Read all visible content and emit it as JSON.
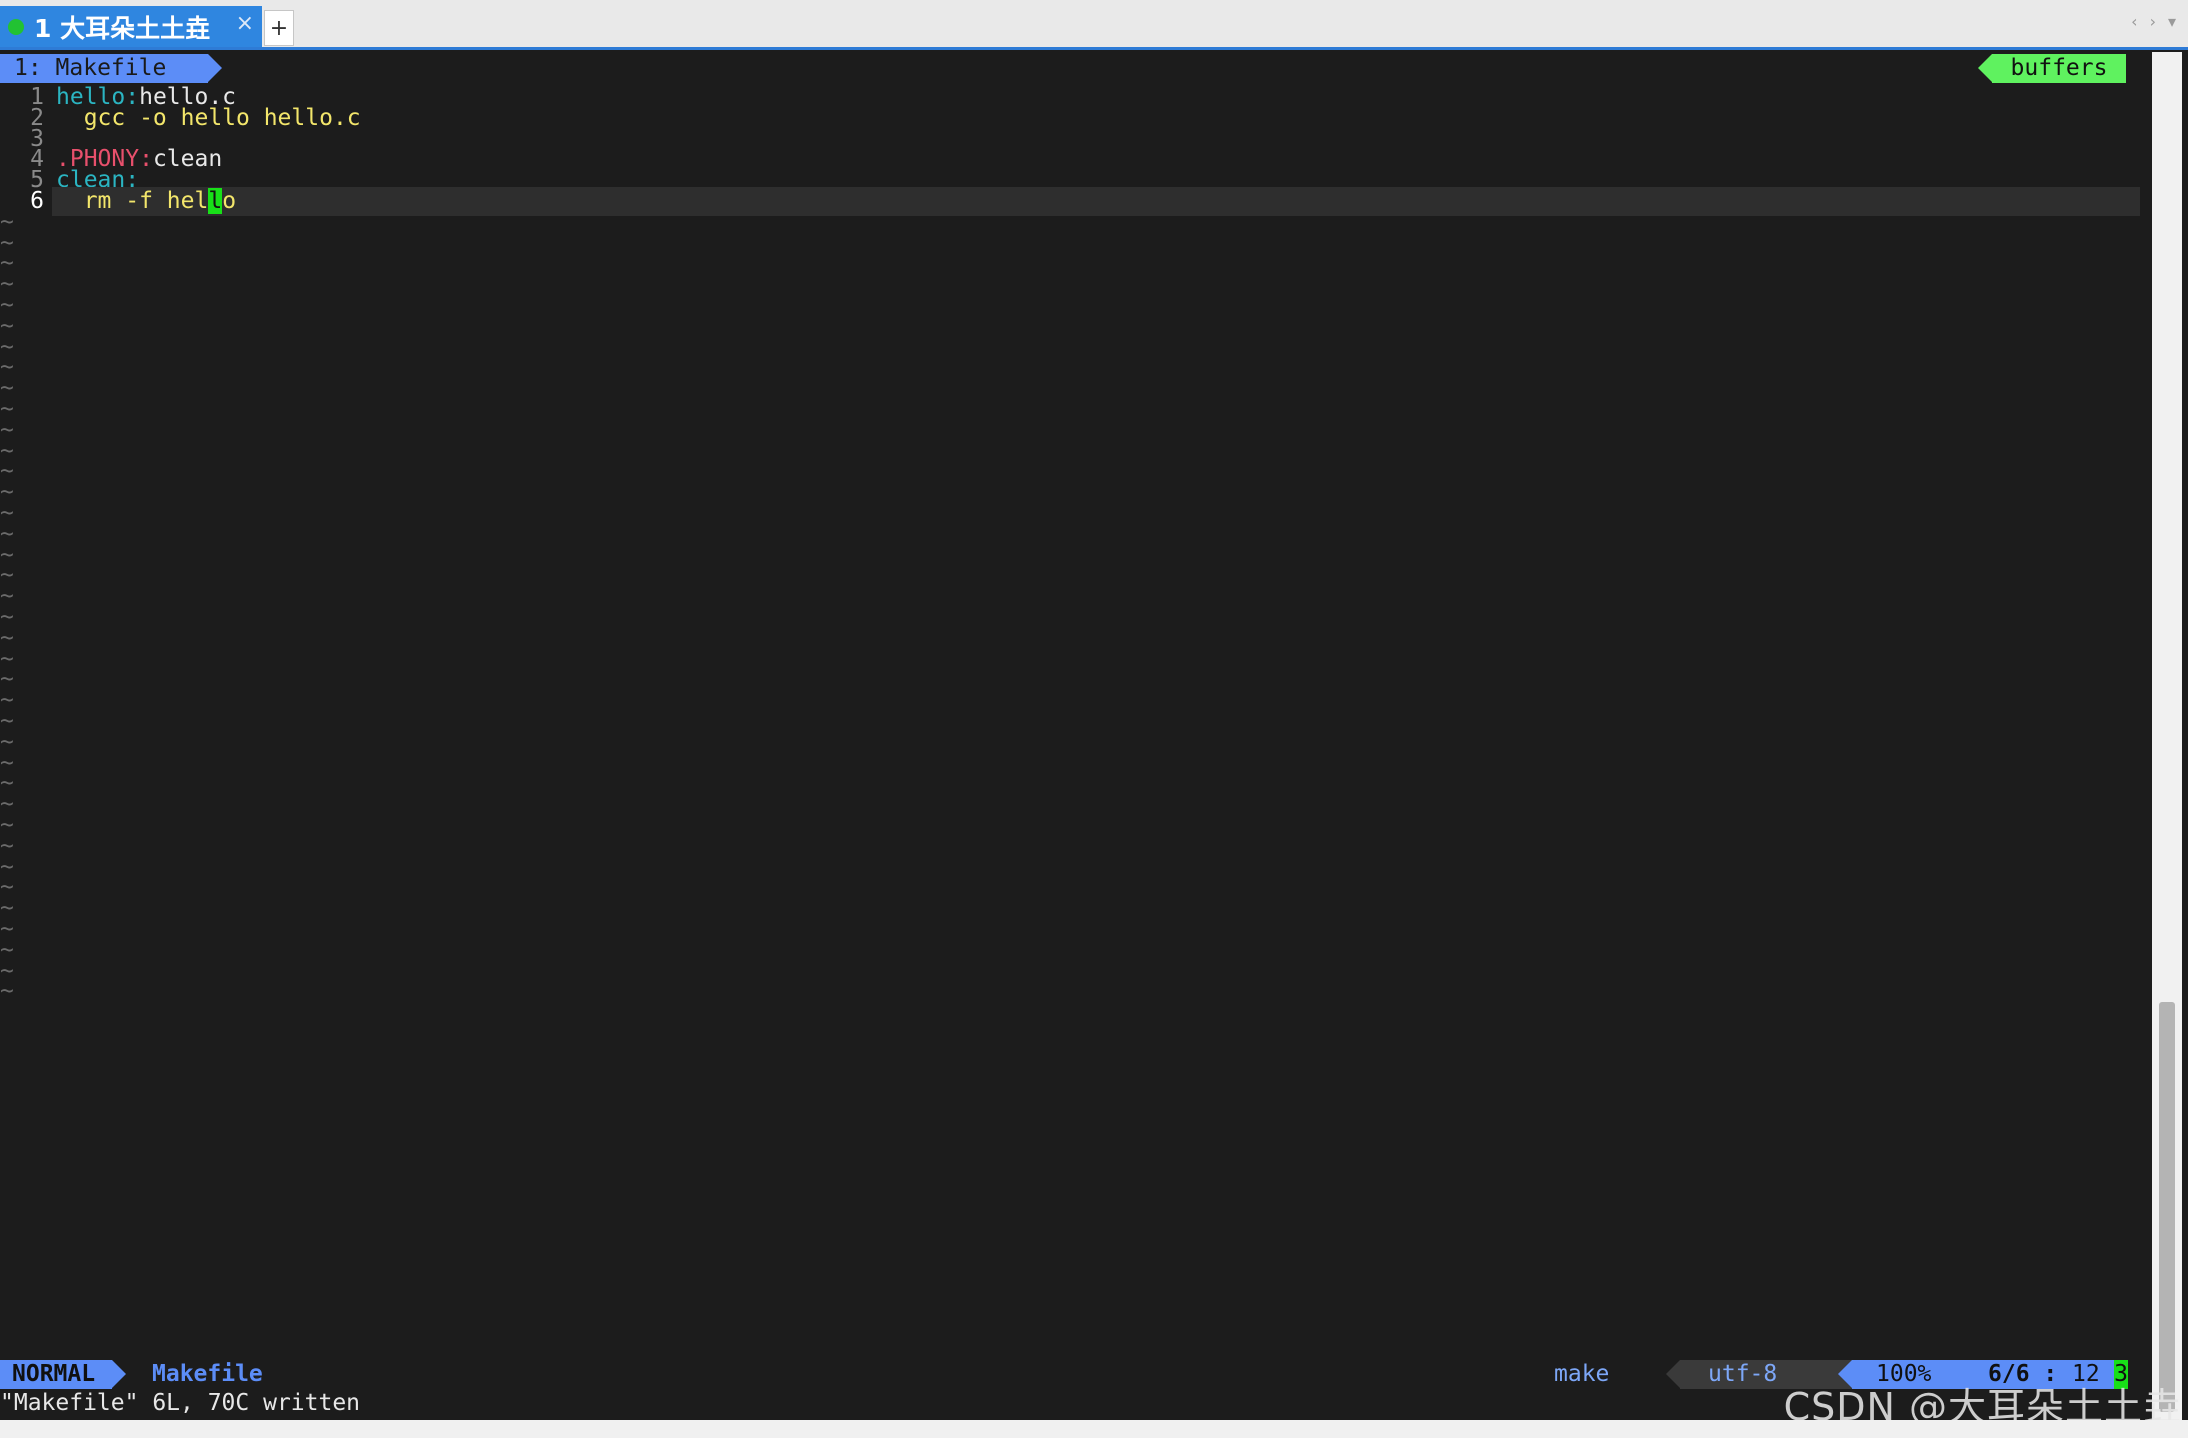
{
  "tabbar": {
    "active_tab_title": "1 大耳朵土土垚",
    "close_glyph": "×",
    "add_glyph": "+",
    "nav_left_glyph": "‹",
    "nav_right_glyph": "›",
    "menu_glyph": "▾",
    "status_dot_color": "#22c232"
  },
  "bufferline": {
    "current_buffer": "1: Makefile",
    "right_label": "buffers"
  },
  "editor": {
    "lines": [
      {
        "number": "1",
        "parts": [
          {
            "text": "hello:",
            "style": "target"
          },
          {
            "text": "hello.c",
            "style": "plain"
          }
        ]
      },
      {
        "number": "2",
        "parts": [
          {
            "text": "  gcc -o hello hello.c",
            "style": "yellow"
          }
        ]
      },
      {
        "number": "3",
        "parts": []
      },
      {
        "number": "4",
        "parts": [
          {
            "text": ".PHONY:",
            "style": "phony"
          },
          {
            "text": "clean",
            "style": "plain"
          }
        ]
      },
      {
        "number": "5",
        "parts": [
          {
            "text": "clean:",
            "style": "target"
          }
        ]
      },
      {
        "number": "6",
        "parts": [
          {
            "text": "  rm -f hel",
            "style": "yellow"
          },
          {
            "text": "l",
            "style": "cursor"
          },
          {
            "text": "o",
            "style": "yellow"
          }
        ],
        "current": true
      }
    ],
    "tilde_glyph": "~",
    "tilde_count": 38
  },
  "statusline": {
    "mode": "NORMAL",
    "filename": "Makefile",
    "filetype": "make",
    "encoding": "utf-8",
    "percent": "100%",
    "position": "6/6 :",
    "column": "12",
    "trailing": "3"
  },
  "cmdline": {
    "message": "\"Makefile\" 6L, 70C written"
  },
  "watermark": {
    "text": "CSDN @大耳朵土土垚"
  },
  "colors": {
    "accent_blue": "#5c8df7",
    "accent_green": "#5ff25f",
    "cursor_green": "#18e018",
    "target_cyan": "#2bb5c2",
    "phony_red": "#e8506c",
    "recipe_yellow": "#f3e66b",
    "background": "#1c1c1c"
  }
}
